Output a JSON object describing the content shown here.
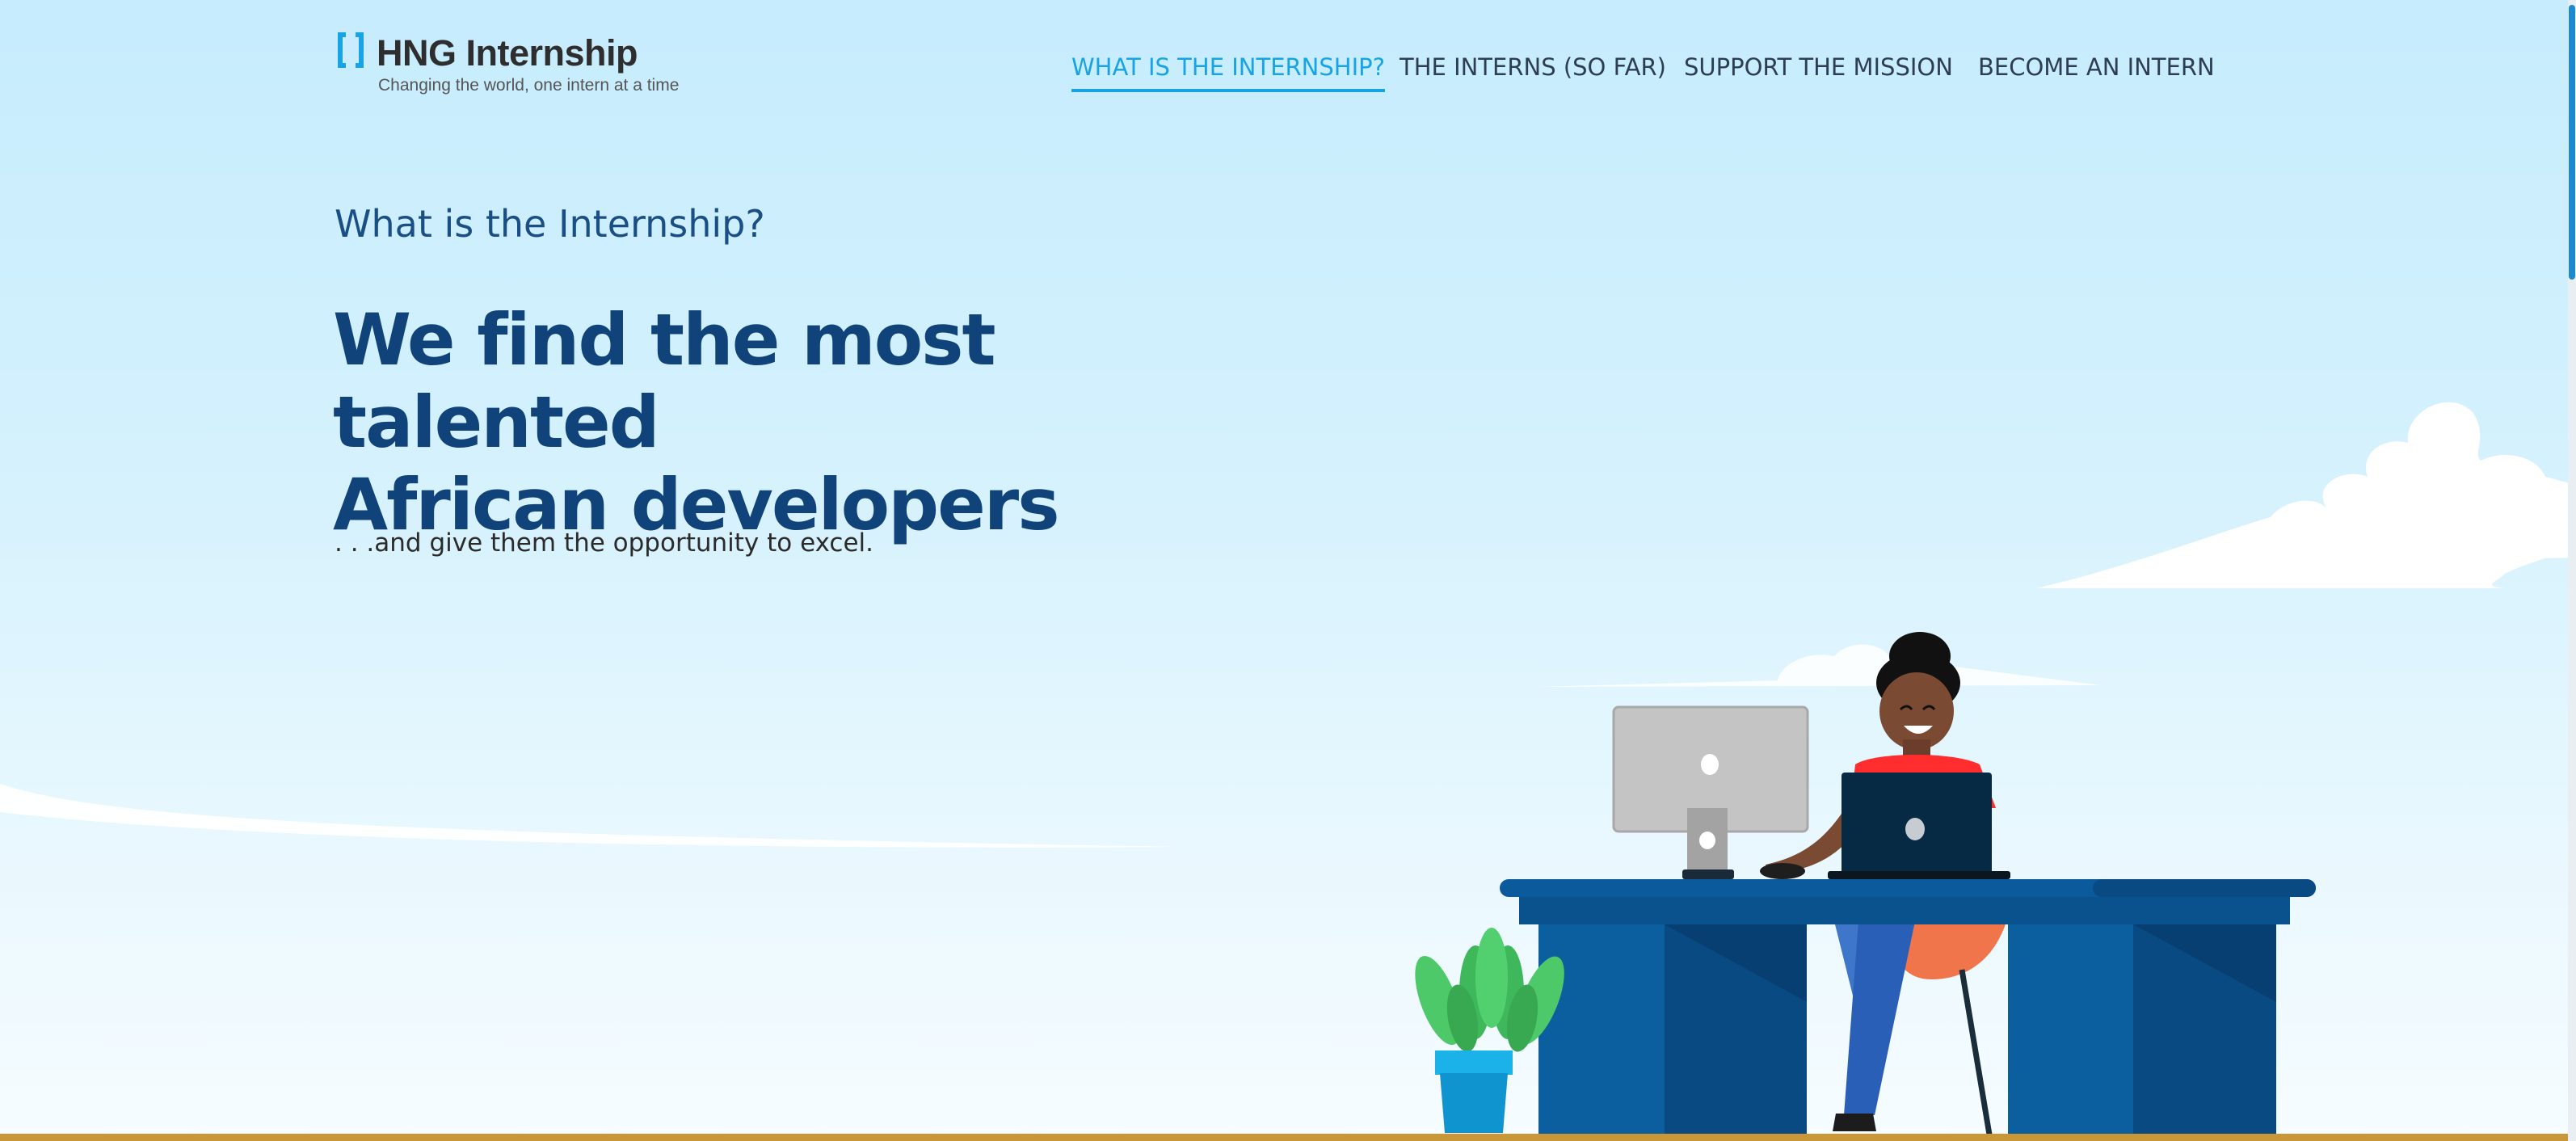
{
  "brand": {
    "title": "HNG Internship",
    "tagline": "Changing the world, one intern at a time",
    "accent": "#18a4e4"
  },
  "nav": {
    "items": [
      {
        "label": "WHAT IS THE INTERNSHIP?",
        "active": true
      },
      {
        "label": "THE INTERNS (SO FAR)",
        "active": false
      },
      {
        "label": "SUPPORT THE MISSION",
        "active": false
      },
      {
        "label": "BECOME AN INTERN",
        "active": false
      }
    ]
  },
  "hero": {
    "eyebrow": "What is the Internship?",
    "headline_line1": "We find the most talented",
    "headline_line2": "African developers",
    "subtext": ". . .and give them the opportunity to excel."
  },
  "colors": {
    "heading": "#0f4379",
    "desk": "#0c5f9f",
    "bottom_bar": "#c99638"
  },
  "icons": [
    "bracket-logo-icon",
    "monitor-icon",
    "laptop-icon",
    "plant-icon"
  ]
}
